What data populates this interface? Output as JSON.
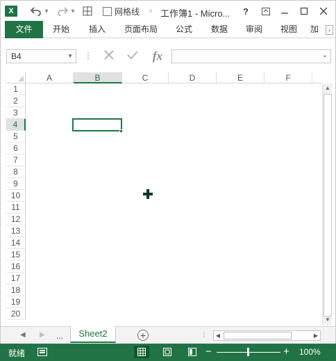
{
  "window": {
    "title": "工作簿1 - Micro...",
    "gridlines_label": "网格线",
    "gridlines_checked": false
  },
  "ribbon": {
    "tabs": [
      {
        "label": "文件"
      },
      {
        "label": "开始"
      },
      {
        "label": "插入"
      },
      {
        "label": "页面布局"
      },
      {
        "label": "公式"
      },
      {
        "label": "数据"
      },
      {
        "label": "审阅"
      },
      {
        "label": "视图"
      },
      {
        "label": "加"
      }
    ],
    "accent_color": "#217346"
  },
  "formula_bar": {
    "name_box": "B4",
    "fx_label": "fx",
    "formula_value": ""
  },
  "grid": {
    "columns": [
      "A",
      "B",
      "C",
      "D",
      "E",
      "F"
    ],
    "rows": [
      "1",
      "2",
      "3",
      "4",
      "5",
      "6",
      "7",
      "8",
      "9",
      "10",
      "11",
      "12",
      "13",
      "14",
      "15",
      "16",
      "17",
      "18",
      "19",
      "20"
    ],
    "active_cell": "B4"
  },
  "sheets": {
    "tabs": [
      {
        "label": "Sheet2"
      }
    ],
    "more_label": "..."
  },
  "status": {
    "text": "就绪",
    "zoom": "100%",
    "zoom_minus": "−",
    "zoom_plus": "+"
  }
}
